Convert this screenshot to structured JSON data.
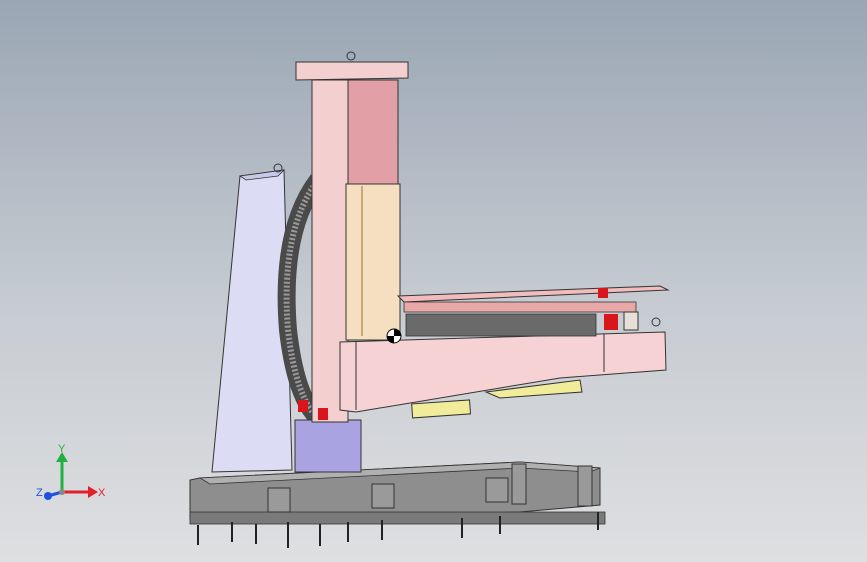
{
  "viewport": {
    "background_top": "#9aa6b4",
    "background_bottom": "#dedfe1"
  },
  "model": {
    "colors": {
      "column": "#f4cfd0",
      "column_shade": "#e2a0a6",
      "side_plate": "#dcdcf4",
      "base_block": "#a9a3e2",
      "arm": "#f6d2d4",
      "table": "#f2bcbc",
      "gear": "#4a4a4a",
      "rail": "#8e8e8e",
      "yellow_part": "#f0ec9a",
      "wood_panel": "#f5dfc0",
      "red_part": "#d8161c"
    }
  },
  "triad": {
    "x_label": "X",
    "y_label": "Y",
    "z_label": "Z",
    "x_color": "#e0202a",
    "y_color": "#22b040",
    "z_color": "#2050e0"
  }
}
